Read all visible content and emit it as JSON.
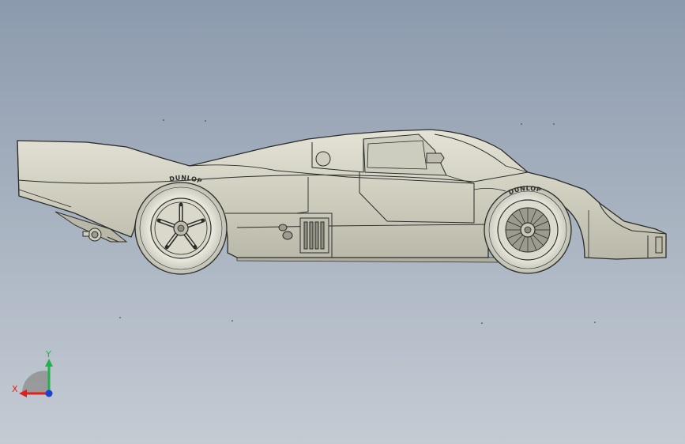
{
  "colors": {
    "body_fill": "#d4d3c5",
    "line": "#2c2c2a",
    "tire": "#d8d8cc",
    "axis_x": "#e0201c",
    "axis_y": "#22b14c",
    "axis_z": "#1f3fd0"
  },
  "car": {
    "rear_tire_brand": "DUNLOP",
    "front_tire_brand": "DUNLOP"
  },
  "triad": {
    "x_label": "X",
    "y_label": "Y"
  }
}
